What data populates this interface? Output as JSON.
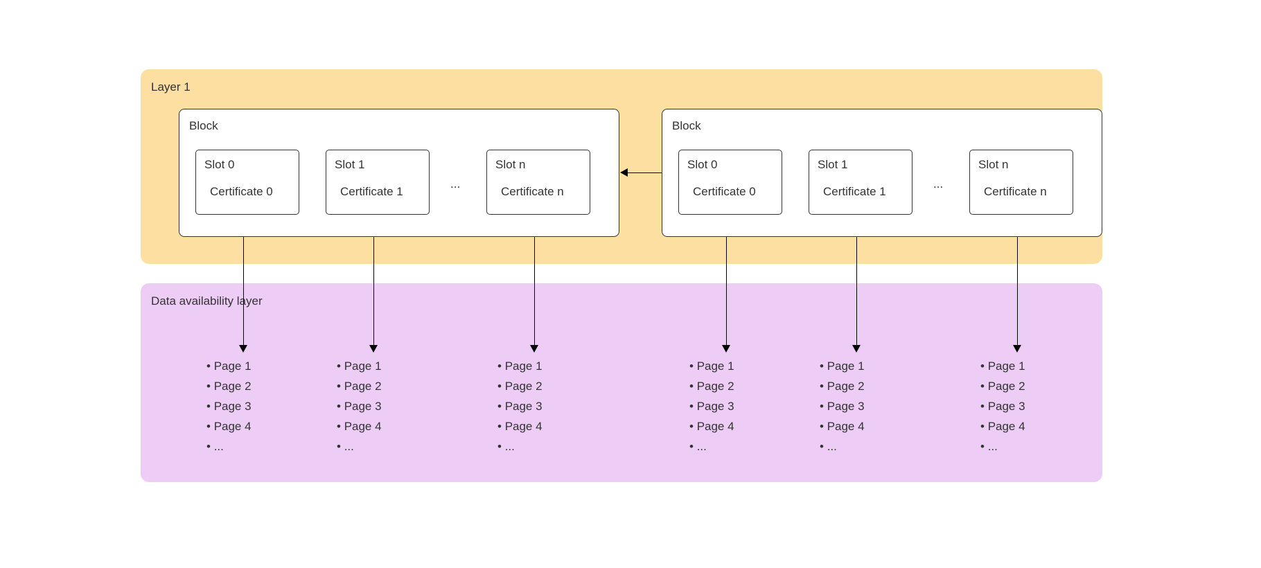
{
  "layer1_title": "Layer 1",
  "da_title": "Data availability layer",
  "blocks": {
    "A": {
      "title": "Block",
      "slots": [
        {
          "title": "Slot 0",
          "cert": "Certificate 0"
        },
        {
          "title": "Slot 1",
          "cert": "Certificate 1"
        },
        {
          "title": "Slot n",
          "cert": "Certificate n"
        }
      ],
      "dots": "..."
    },
    "B": {
      "title": "Block",
      "slots": [
        {
          "title": "Slot 0",
          "cert": "Certificate 0"
        },
        {
          "title": "Slot 1",
          "cert": "Certificate 1"
        },
        {
          "title": "Slot n",
          "cert": "Certificate n"
        }
      ],
      "dots": "..."
    }
  },
  "pages": {
    "items": [
      "Page 1",
      "Page 2",
      "Page 3",
      "Page 4",
      "..."
    ]
  }
}
